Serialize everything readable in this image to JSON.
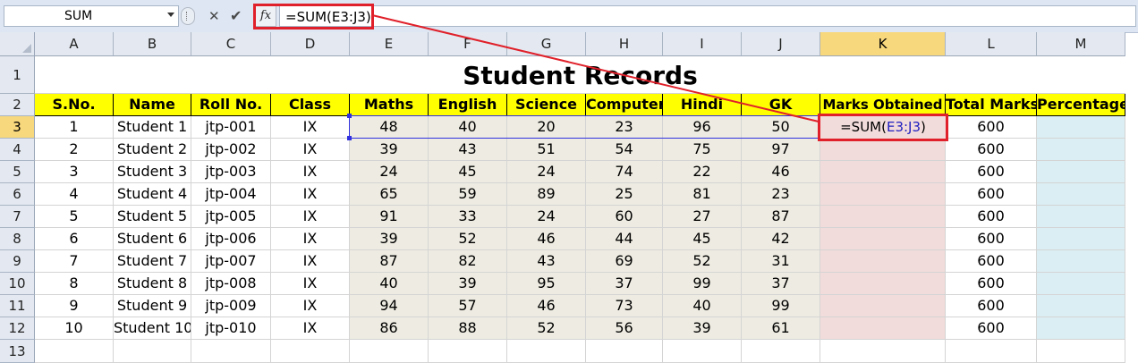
{
  "formula_bar": {
    "name_box": "SUM",
    "fx_label": "fx",
    "formula": "=SUM(E3:J3)"
  },
  "columns": [
    "A",
    "B",
    "C",
    "D",
    "E",
    "F",
    "G",
    "H",
    "I",
    "J",
    "K",
    "L",
    "M"
  ],
  "row_numbers": [
    "1",
    "2",
    "3",
    "4",
    "5",
    "6",
    "7",
    "8",
    "9",
    "10",
    "11",
    "12",
    "13"
  ],
  "sheet_title": "Student Records",
  "headers": [
    "S.No.",
    "Name",
    "Roll No.",
    "Class",
    "Maths",
    "English",
    "Science",
    "Computer",
    "Hindi",
    "GK",
    "Marks Obtained",
    "Total Marks",
    "Percentage"
  ],
  "rows": [
    [
      "1",
      "Student 1",
      "jtp-001",
      "IX",
      "48",
      "40",
      "20",
      "23",
      "96",
      "50",
      "",
      "600",
      ""
    ],
    [
      "2",
      "Student 2",
      "jtp-002",
      "IX",
      "39",
      "43",
      "51",
      "54",
      "75",
      "97",
      "",
      "600",
      ""
    ],
    [
      "3",
      "Student 3",
      "jtp-003",
      "IX",
      "24",
      "45",
      "24",
      "74",
      "22",
      "46",
      "",
      "600",
      ""
    ],
    [
      "4",
      "Student 4",
      "jtp-004",
      "IX",
      "65",
      "59",
      "89",
      "25",
      "81",
      "23",
      "",
      "600",
      ""
    ],
    [
      "5",
      "Student 5",
      "jtp-005",
      "IX",
      "91",
      "33",
      "24",
      "60",
      "27",
      "87",
      "",
      "600",
      ""
    ],
    [
      "6",
      "Student 6",
      "jtp-006",
      "IX",
      "39",
      "52",
      "46",
      "44",
      "45",
      "42",
      "",
      "600",
      ""
    ],
    [
      "7",
      "Student 7",
      "jtp-007",
      "IX",
      "87",
      "82",
      "43",
      "69",
      "52",
      "31",
      "",
      "600",
      ""
    ],
    [
      "8",
      "Student 8",
      "jtp-008",
      "IX",
      "40",
      "39",
      "95",
      "37",
      "99",
      "37",
      "",
      "600",
      ""
    ],
    [
      "9",
      "Student 9",
      "jtp-009",
      "IX",
      "94",
      "57",
      "46",
      "73",
      "40",
      "99",
      "",
      "600",
      ""
    ],
    [
      "10",
      "Student 10",
      "jtp-010",
      "IX",
      "86",
      "88",
      "52",
      "56",
      "39",
      "61",
      "",
      "600",
      ""
    ]
  ],
  "active_cell": {
    "prefix": "=SUM(",
    "ref": "E3:J3",
    "suffix": ")"
  },
  "colors": {
    "header_fill": "#ffff00",
    "marks_fill": "#eeece2",
    "marks_obtained_fill": "#f2dcdb",
    "percentage_fill": "#dbeef3",
    "highlight": "#e0202a",
    "range_ref": "#2020c0"
  }
}
